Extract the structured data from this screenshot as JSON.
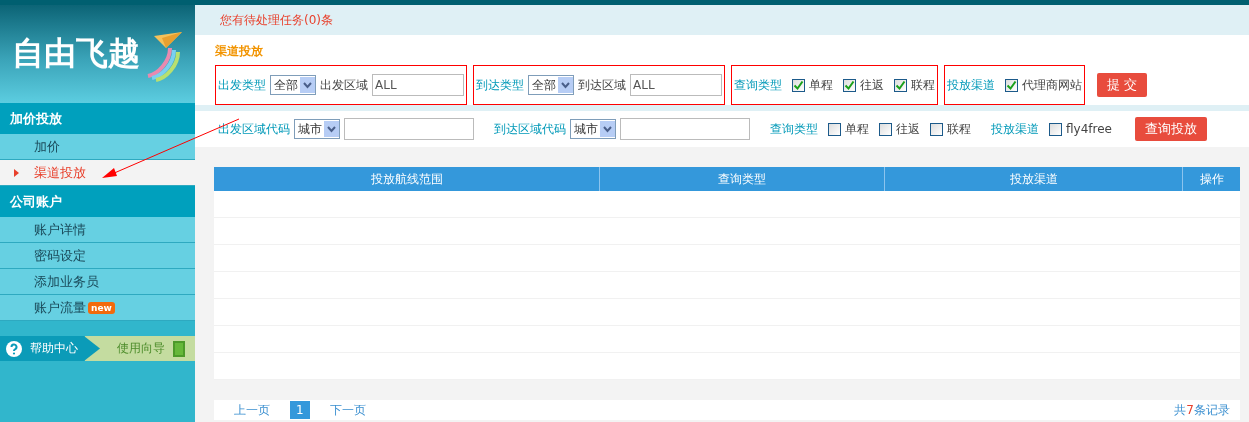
{
  "sidebar": {
    "logo_text": "自由飞越",
    "sections": [
      {
        "title": "加价投放",
        "items": [
          {
            "label": "加价",
            "selected": false
          },
          {
            "label": "渠道投放",
            "selected": true
          }
        ]
      },
      {
        "title": "公司账户",
        "items": [
          {
            "label": "账户详情",
            "selected": false
          },
          {
            "label": "密码设定",
            "selected": false
          },
          {
            "label": "添加业务员",
            "selected": false
          },
          {
            "label": "账户流量",
            "selected": false,
            "badge": "new"
          }
        ]
      }
    ],
    "help": {
      "label": "帮助中心",
      "guide": "使用向导"
    }
  },
  "notice": "您有待处理任务(0)条",
  "section_title": "渠道投放",
  "form_rows": [
    {
      "groups": [
        {
          "kind": "select",
          "highlighted": true,
          "label": "出发类型",
          "select": "全部",
          "field_label": "出发区域",
          "value": "ALL"
        },
        {
          "kind": "select",
          "highlighted": true,
          "label": "到达类型",
          "select": "全部",
          "field_label": "到达区域",
          "value": "ALL"
        },
        {
          "kind": "checks",
          "highlighted": true,
          "label": "查询类型",
          "options": [
            {
              "label": "单程",
              "checked": true
            },
            {
              "label": "往返",
              "checked": true
            },
            {
              "label": "联程",
              "checked": true
            }
          ]
        },
        {
          "kind": "checks",
          "highlighted": true,
          "label": "投放渠道",
          "options": [
            {
              "label": "代理商网站",
              "checked": true
            }
          ]
        }
      ],
      "button": "提 交"
    },
    {
      "groups": [
        {
          "kind": "select",
          "highlighted": false,
          "label": "出发区域代码",
          "select": "城市"
        },
        {
          "kind": "select",
          "highlighted": false,
          "label": "到达区域代码",
          "select": "城市"
        },
        {
          "kind": "checks",
          "highlighted": false,
          "label": "查询类型",
          "options": [
            {
              "label": "单程",
              "checked": false
            },
            {
              "label": "往返",
              "checked": false
            },
            {
              "label": "联程",
              "checked": false
            }
          ]
        },
        {
          "kind": "checks",
          "highlighted": false,
          "label": "投放渠道",
          "options": [
            {
              "label": "fly4free",
              "checked": false
            }
          ]
        }
      ],
      "button": "查询投放"
    }
  ],
  "table": {
    "columns": [
      "投放航线范围",
      "查询类型",
      "投放渠道",
      "操作"
    ]
  },
  "pagination": {
    "prev": "上一页",
    "pages": [
      {
        "label": "1",
        "selected": true
      }
    ],
    "next": "下一页",
    "total": {
      "prefix": "共",
      "count": "7",
      "suffix": "条记录"
    }
  }
}
